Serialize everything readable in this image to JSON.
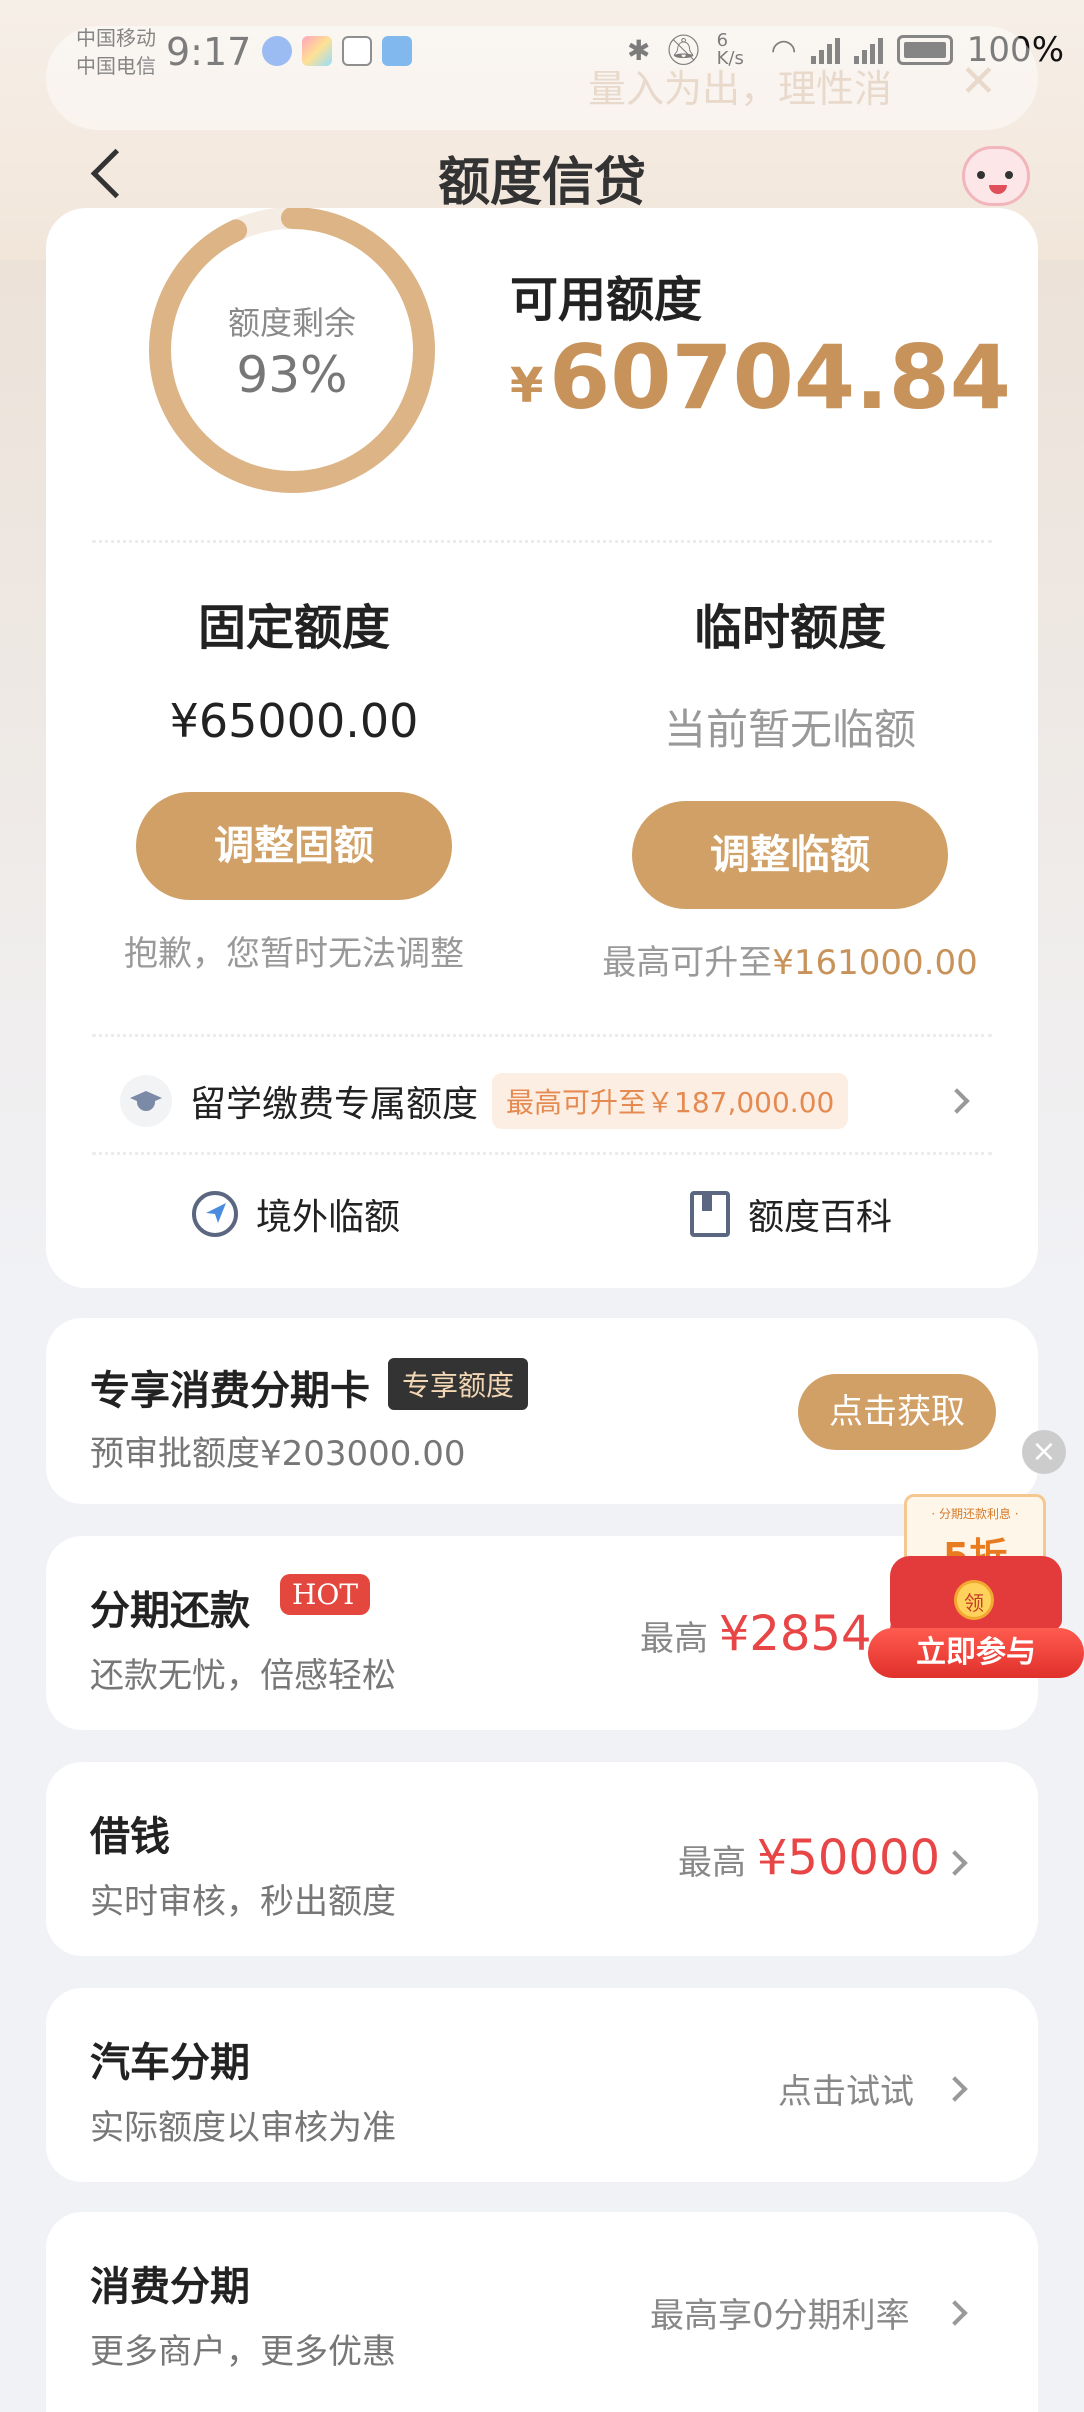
{
  "status_bar": {
    "carrier1": "中国移动",
    "carrier2": "中国电信",
    "time": "9:17",
    "speed": "6 K/s",
    "battery": "100%"
  },
  "ghost_banner": {
    "text": "量入为出，理性消",
    "close": "✕"
  },
  "nav": {
    "title": "额度信贷"
  },
  "credit": {
    "ring_label": "额度剩余",
    "ring_percent": "93%",
    "ring_fraction": 0.93,
    "available_label": "可用额度",
    "currency": "¥",
    "available_amount": "60704.84",
    "fixed": {
      "title": "固定额度",
      "value": "¥65000.00",
      "button": "调整固额",
      "note": "抱歉，您暂时无法调整"
    },
    "temp": {
      "title": "临时额度",
      "value": "当前暂无临额",
      "button": "调整临额",
      "note_prefix": "最高可升至",
      "note_amount": "¥161000.00"
    },
    "study": {
      "label": "留学缴费专属额度",
      "tag": "最高可升至￥187,000.00"
    },
    "tools": {
      "overseas": "境外临额",
      "wiki": "额度百科"
    }
  },
  "cards": {
    "installment_card": {
      "title": "专享消费分期卡",
      "badge": "专享额度",
      "sub": "预审批额度¥203000.00",
      "button": "点击获取"
    },
    "repay": {
      "title": "分期还款",
      "badge": "HOT",
      "sub": "还款无忧，倍感轻松",
      "right_prefix": "最高",
      "right_amount": "¥2854.0"
    },
    "borrow": {
      "title": "借钱",
      "sub": "实时审核，秒出额度",
      "right_prefix": "最高",
      "right_amount": "¥50000"
    },
    "car": {
      "title": "汽车分期",
      "sub": "实际额度以审核为准",
      "right": "点击试试"
    },
    "consume": {
      "title": "消费分期",
      "sub": "更多商户，更多优惠",
      "right": "最高享0分期利率"
    }
  },
  "promo": {
    "small": "· 分期还款利息 ·",
    "discount": "5折",
    "coin": "领",
    "button": "立即参与"
  },
  "colors": {
    "accent": "#d0a066",
    "gold_text": "#c8935a",
    "red": "#e84646",
    "bg": "#f1f2f6"
  }
}
